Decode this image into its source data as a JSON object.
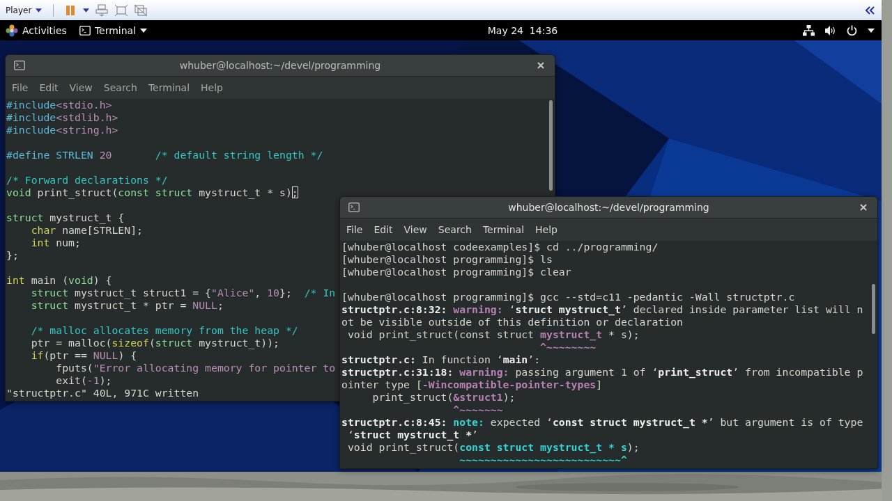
{
  "player_toolbar": {
    "menu": "Player"
  },
  "top_bar": {
    "activities": "Activities",
    "app_menu": "Terminal",
    "clock": "May 24  14:36"
  },
  "windows": [
    {
      "kind": "editor",
      "title": "whuber@localhost:~/devel/programming",
      "menu": [
        "File",
        "Edit",
        "View",
        "Search",
        "Terminal",
        "Help"
      ],
      "lines": [
        {
          "kind": "text",
          "segments": [
            {
              "kind": "pre",
              "text": "#include"
            },
            {
              "kind": "const",
              "text": "<stdio.h>"
            }
          ]
        },
        {
          "kind": "text",
          "segments": [
            {
              "kind": "pre",
              "text": "#include"
            },
            {
              "kind": "const",
              "text": "<stdlib.h>"
            }
          ]
        },
        {
          "kind": "text",
          "segments": [
            {
              "kind": "pre",
              "text": "#include"
            },
            {
              "kind": "const",
              "text": "<string.h>"
            }
          ]
        },
        {
          "kind": "blank"
        },
        {
          "kind": "text",
          "segments": [
            {
              "kind": "pre",
              "text": "#define STRLEN "
            },
            {
              "kind": "const",
              "text": "20"
            },
            {
              "kind": "comment",
              "text": "       /* default string length */"
            }
          ]
        },
        {
          "kind": "blank"
        },
        {
          "kind": "text",
          "segments": [
            {
              "kind": "comment",
              "text": "/* Forward declarations */"
            }
          ]
        },
        {
          "kind": "text",
          "segments": [
            {
              "kind": "type",
              "text": "void"
            },
            {
              "kind": "plain",
              "text": " print_struct("
            },
            {
              "kind": "type",
              "text": "const struct"
            },
            {
              "kind": "plain",
              "text": " mystruct_t * s)"
            },
            {
              "kind": "cursor",
              "text": ";"
            }
          ]
        },
        {
          "kind": "blank"
        },
        {
          "kind": "text",
          "segments": [
            {
              "kind": "type",
              "text": "struct"
            },
            {
              "kind": "plain",
              "text": " mystruct_t {"
            }
          ]
        },
        {
          "kind": "text",
          "segments": [
            {
              "kind": "keyword",
              "text": "    char"
            },
            {
              "kind": "plain",
              "text": " name[STRLEN];"
            }
          ]
        },
        {
          "kind": "text",
          "segments": [
            {
              "kind": "keyword",
              "text": "    int"
            },
            {
              "kind": "plain",
              "text": " num;"
            }
          ]
        },
        {
          "kind": "text",
          "segments": [
            {
              "kind": "plain",
              "text": "};"
            }
          ]
        },
        {
          "kind": "blank"
        },
        {
          "kind": "text",
          "segments": [
            {
              "kind": "keyword",
              "text": "int"
            },
            {
              "kind": "plain",
              "text": " main ("
            },
            {
              "kind": "type",
              "text": "void"
            },
            {
              "kind": "plain",
              "text": ") {"
            }
          ]
        },
        {
          "kind": "text",
          "segments": [
            {
              "kind": "type",
              "text": "    struct"
            },
            {
              "kind": "plain",
              "text": " mystruct_t struct1 = {"
            },
            {
              "kind": "const",
              "text": "\"Alice\""
            },
            {
              "kind": "plain",
              "text": ", "
            },
            {
              "kind": "const",
              "text": "10"
            },
            {
              "kind": "plain",
              "text": "};  "
            },
            {
              "kind": "comment",
              "text": "/* In"
            }
          ]
        },
        {
          "kind": "text",
          "segments": [
            {
              "kind": "type",
              "text": "    struct"
            },
            {
              "kind": "plain",
              "text": " mystruct_t * ptr = "
            },
            {
              "kind": "const",
              "text": "NULL"
            },
            {
              "kind": "plain",
              "text": ";"
            }
          ]
        },
        {
          "kind": "blank"
        },
        {
          "kind": "text",
          "segments": [
            {
              "kind": "comment",
              "text": "    /* malloc allocates memory from the heap */"
            }
          ]
        },
        {
          "kind": "text",
          "segments": [
            {
              "kind": "plain",
              "text": "    ptr = malloc("
            },
            {
              "kind": "keyword",
              "text": "sizeof"
            },
            {
              "kind": "plain",
              "text": "("
            },
            {
              "kind": "type",
              "text": "struct"
            },
            {
              "kind": "plain",
              "text": " mystruct_t));"
            }
          ]
        },
        {
          "kind": "text",
          "segments": [
            {
              "kind": "keyword",
              "text": "    if"
            },
            {
              "kind": "plain",
              "text": "(ptr == "
            },
            {
              "kind": "const",
              "text": "NULL"
            },
            {
              "kind": "plain",
              "text": ") {"
            }
          ]
        },
        {
          "kind": "text",
          "segments": [
            {
              "kind": "plain",
              "text": "        fputs("
            },
            {
              "kind": "const",
              "text": "\"Error allocating memory for pointer to"
            }
          ]
        },
        {
          "kind": "text",
          "segments": [
            {
              "kind": "plain",
              "text": "        exit("
            },
            {
              "kind": "const",
              "text": "-1"
            },
            {
              "kind": "plain",
              "text": ");"
            }
          ]
        },
        {
          "kind": "text",
          "segments": [
            {
              "kind": "plain",
              "text": "\"structptr.c\" 40L, 971C written"
            }
          ]
        }
      ]
    },
    {
      "kind": "shell",
      "title": "whuber@localhost:~/devel/programming",
      "menu": [
        "File",
        "Edit",
        "View",
        "Search",
        "Terminal",
        "Help"
      ],
      "lines": [
        {
          "kind": "text",
          "segments": [
            {
              "kind": "plain",
              "text": "[whuber@localhost codeexamples]$ cd ../programming/"
            }
          ]
        },
        {
          "kind": "text",
          "segments": [
            {
              "kind": "plain",
              "text": "[whuber@localhost programming]$ ls"
            }
          ]
        },
        {
          "kind": "text",
          "segments": [
            {
              "kind": "plain",
              "text": "[whuber@localhost programming]$ clear"
            }
          ]
        },
        {
          "kind": "blank"
        },
        {
          "kind": "text",
          "segments": [
            {
              "kind": "plain",
              "text": "[whuber@localhost programming]$ gcc --std=c11 -pedantic -Wall structptr.c"
            }
          ]
        },
        {
          "kind": "text",
          "segments": [
            {
              "kind": "bold",
              "text": "structptr.c:8:32: "
            },
            {
              "kind": "magenta",
              "text": "warning: "
            },
            {
              "kind": "plain",
              "text": "‘"
            },
            {
              "kind": "bold",
              "text": "struct mystruct_t"
            },
            {
              "kind": "plain",
              "text": "’ declared inside parameter list will n"
            }
          ]
        },
        {
          "kind": "text",
          "segments": [
            {
              "kind": "plain",
              "text": "ot be visible outside of this definition or declaration"
            }
          ]
        },
        {
          "kind": "text",
          "segments": [
            {
              "kind": "plain",
              "text": " void print_struct(const struct "
            },
            {
              "kind": "magenta",
              "text": "mystruct_t"
            },
            {
              "kind": "plain",
              "text": " * s);"
            }
          ]
        },
        {
          "kind": "text",
          "segments": [
            {
              "kind": "magenta",
              "text": "                                ^~~~~~~~~"
            }
          ]
        },
        {
          "kind": "text",
          "segments": [
            {
              "kind": "bold",
              "text": "structptr.c:"
            },
            {
              "kind": "plain",
              "text": " In function ‘"
            },
            {
              "kind": "bold",
              "text": "main"
            },
            {
              "kind": "plain",
              "text": "’:"
            }
          ]
        },
        {
          "kind": "text",
          "segments": [
            {
              "kind": "bold",
              "text": "structptr.c:31:18: "
            },
            {
              "kind": "magenta",
              "text": "warning: "
            },
            {
              "kind": "plain",
              "text": "passing argument 1 of ‘"
            },
            {
              "kind": "bold",
              "text": "print_struct"
            },
            {
              "kind": "plain",
              "text": "’ from incompatible p"
            }
          ]
        },
        {
          "kind": "text",
          "segments": [
            {
              "kind": "plain",
              "text": "ointer type ["
            },
            {
              "kind": "magenta",
              "text": "-Wincompatible-pointer-types"
            },
            {
              "kind": "plain",
              "text": "]"
            }
          ]
        },
        {
          "kind": "text",
          "segments": [
            {
              "kind": "plain",
              "text": "     print_struct("
            },
            {
              "kind": "magenta",
              "text": "&struct1"
            },
            {
              "kind": "plain",
              "text": ");"
            }
          ]
        },
        {
          "kind": "text",
          "segments": [
            {
              "kind": "magenta",
              "text": "                  ^~~~~~~~"
            }
          ]
        },
        {
          "kind": "text",
          "segments": [
            {
              "kind": "bold",
              "text": "structptr.c:8:45: "
            },
            {
              "kind": "cyan",
              "text": "note: "
            },
            {
              "kind": "plain",
              "text": "expected ‘"
            },
            {
              "kind": "bold",
              "text": "const struct mystruct_t *"
            },
            {
              "kind": "plain",
              "text": "’ but argument is of type"
            }
          ]
        },
        {
          "kind": "text",
          "segments": [
            {
              "kind": "plain",
              "text": " ‘"
            },
            {
              "kind": "bold",
              "text": "struct mystruct_t *"
            },
            {
              "kind": "plain",
              "text": "’"
            }
          ]
        },
        {
          "kind": "text",
          "segments": [
            {
              "kind": "plain",
              "text": " void print_struct("
            },
            {
              "kind": "cyan",
              "text": "const struct mystruct_t * s"
            },
            {
              "kind": "plain",
              "text": ");"
            }
          ]
        },
        {
          "kind": "text",
          "segments": [
            {
              "kind": "cyan",
              "text": "                   ~~~~~~~~~~~~~~~~~~~~~~~~~~^"
            }
          ]
        }
      ]
    }
  ]
}
